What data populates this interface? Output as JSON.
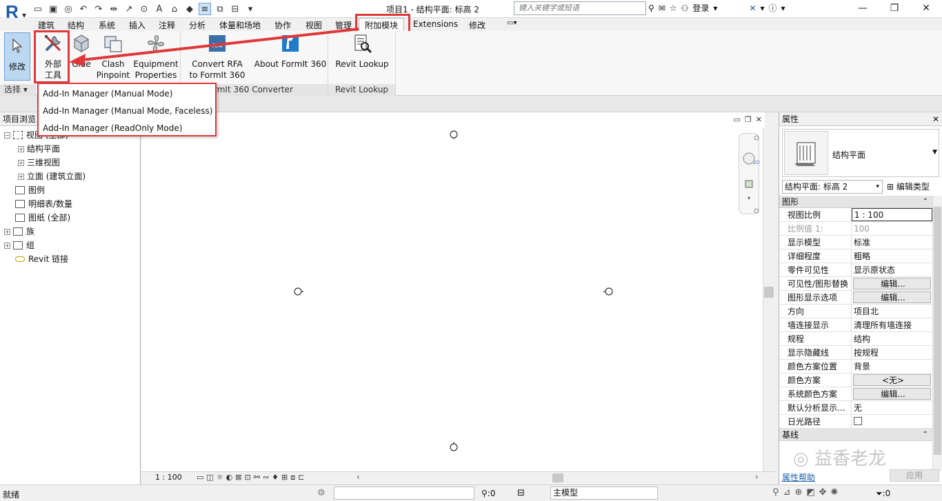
{
  "window": {
    "title": "项目1 - 结构平面: 标高 2",
    "search_placeholder": "键入关键字或短语",
    "login": "登录",
    "minimize": "—",
    "restore": "❐",
    "close": "✕"
  },
  "app_logo": "R",
  "ribbon_tabs": [
    "建筑",
    "结构",
    "系统",
    "插入",
    "注释",
    "分析",
    "体量和场地",
    "协作",
    "视图",
    "管理",
    "附加模块",
    "Extensions",
    "修改"
  ],
  "active_tab": "附加模块",
  "ribbon": {
    "modify_label": "修改",
    "select_label": "选择",
    "external_tools_label_1": "外部",
    "external_tools_label_2": "工具",
    "glue_label": "Glue",
    "clash_label_1": "Clash",
    "clash_label_2": "Pinpoint",
    "equipment_label_1": "Equipment",
    "equipment_label_2": "Properties",
    "convert_label_1": "Convert RFA",
    "convert_label_2": "to FormIt 360",
    "about_label": "About FormIt 360",
    "formit_group": "FormIt 360 Converter",
    "formit_group_visible": "rmIt 360 Converter",
    "lookup_label_1": "Revit Lookup",
    "lookup_group": "Revit Lookup"
  },
  "addin_menu": [
    "Add-In Manager (Manual Mode)",
    "Add-In Manager (Manual Mode, Faceless)",
    "Add-In Manager (ReadOnly Mode)"
  ],
  "project_browser": {
    "title": "项目浏览",
    "root": "视图 (全部)",
    "items": [
      {
        "label": "结构平面",
        "level": 2,
        "expander": "+"
      },
      {
        "label": "三维视图",
        "level": 2,
        "expander": "+"
      },
      {
        "label": "立面 (建筑立面)",
        "level": 2,
        "expander": "+"
      },
      {
        "label": "图例",
        "level": 1,
        "expander": ""
      },
      {
        "label": "明细表/数量",
        "level": 1,
        "expander": ""
      },
      {
        "label": "图纸 (全部)",
        "level": 1,
        "expander": ""
      },
      {
        "label": "族",
        "level": 1,
        "expander": "+"
      },
      {
        "label": "组",
        "level": 1,
        "expander": "+"
      },
      {
        "label": "Revit 链接",
        "level": 1,
        "expander": ""
      }
    ]
  },
  "view_control": {
    "scale": "1 : 100"
  },
  "properties": {
    "title": "属性",
    "type_name": "结构平面",
    "instance": "结构平面: 标高 2",
    "edit_type": "编辑类型",
    "group_graphics": "图形",
    "group_underlay": "基线",
    "rows": [
      {
        "name": "视图比例",
        "value": "1 : 100",
        "kind": "input"
      },
      {
        "name": "比例值 1:",
        "value": "100",
        "kind": "disabled"
      },
      {
        "name": "显示模型",
        "value": "标准",
        "kind": "text"
      },
      {
        "name": "详细程度",
        "value": "粗略",
        "kind": "text"
      },
      {
        "name": "零件可见性",
        "value": "显示原状态",
        "kind": "text"
      },
      {
        "name": "可见性/图形替换",
        "value": "编辑...",
        "kind": "button"
      },
      {
        "name": "图形显示选项",
        "value": "编辑...",
        "kind": "button"
      },
      {
        "name": "方向",
        "value": "项目北",
        "kind": "text"
      },
      {
        "name": "墙连接显示",
        "value": "清理所有墙连接",
        "kind": "text"
      },
      {
        "name": "规程",
        "value": "结构",
        "kind": "text"
      },
      {
        "name": "显示隐藏线",
        "value": "按规程",
        "kind": "text"
      },
      {
        "name": "颜色方案位置",
        "value": "背景",
        "kind": "text"
      },
      {
        "name": "颜色方案",
        "value": "<无>",
        "kind": "button"
      },
      {
        "name": "系统颜色方案",
        "value": "编辑...",
        "kind": "button"
      },
      {
        "name": "默认分析显示...",
        "value": "无",
        "kind": "text"
      },
      {
        "name": "日光路径",
        "value": "",
        "kind": "checkbox"
      }
    ],
    "help": "属性帮助",
    "apply": "应用"
  },
  "watermark": "益香老龙",
  "status": {
    "text": "就绪",
    "count1": ":0",
    "model": "主模型",
    "count2": ":0"
  },
  "colors": {
    "accent": "#e03838",
    "brand": "#1a5ea8",
    "active_button": "#bcd8f0"
  }
}
